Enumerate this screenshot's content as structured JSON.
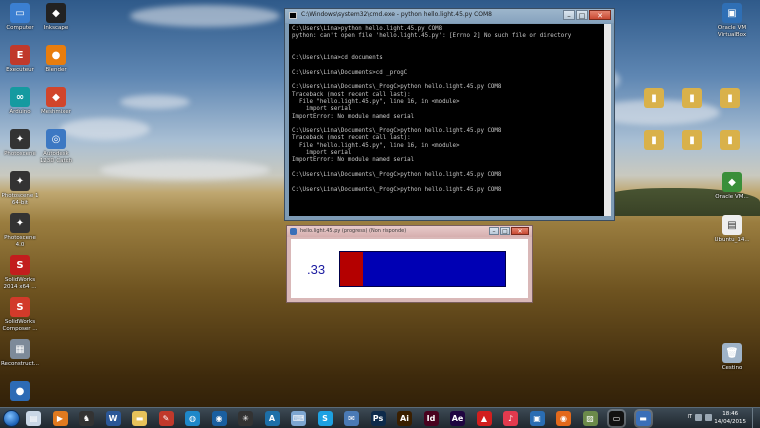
{
  "desktop": {
    "icons_left": [
      {
        "label": "Computer",
        "color": "#3b7fd1",
        "glyph": "▭"
      },
      {
        "label": "Executeur",
        "color": "#c0392b",
        "glyph": "E"
      },
      {
        "label": "Arduino",
        "color": "#159aa0",
        "glyph": "∞"
      },
      {
        "label": "Photoscene",
        "color": "#333333",
        "glyph": "✦"
      },
      {
        "label": "Photoscene 1 64-bit",
        "color": "#333333",
        "glyph": "✦"
      },
      {
        "label": "Photoscene 4.0",
        "color": "#333333",
        "glyph": "✦"
      },
      {
        "label": "SolidWorks 2014 x64 ...",
        "color": "#c21d1d",
        "glyph": "S"
      },
      {
        "label": "SolidWorks Composer ...",
        "color": "#d23a2a",
        "glyph": "S"
      },
      {
        "label": "Reconstruct...",
        "color": "#7d8a99",
        "glyph": "▦"
      },
      {
        "label": "",
        "color": "#2d6bb5",
        "glyph": "●"
      }
    ],
    "icons_left2": [
      {
        "label": "Inkscape",
        "color": "#222222",
        "glyph": "◆"
      },
      {
        "label": "Blender",
        "color": "#e87d0d",
        "glyph": "●"
      },
      {
        "label": "Meshmixer",
        "color": "#d1452b",
        "glyph": "◆"
      },
      {
        "label": "Autodesk 123D Catch",
        "color": "#3c78c3",
        "glyph": "◎"
      }
    ],
    "icons_mid": [
      {
        "label": "",
        "color": "#d9b14a",
        "glyph": "▮"
      },
      {
        "label": "",
        "color": "#d9b14a",
        "glyph": "▮"
      },
      {
        "label": "",
        "color": "#d9b14a",
        "glyph": "▮"
      },
      {
        "label": "",
        "color": "#d9b14a",
        "glyph": "▮"
      },
      {
        "label": "",
        "color": "#d9b14a",
        "glyph": "▮"
      },
      {
        "label": "",
        "color": "#d9b14a",
        "glyph": "▮"
      }
    ],
    "icons_right": [
      {
        "label": "Oracle VM VirtualBox",
        "color": "#2f6fb5",
        "glyph": "▣"
      },
      {
        "label": "Oracle VM...",
        "color": "#3a8f3a",
        "glyph": "◆"
      },
      {
        "label": "Ubuntu_14...",
        "color": "#eeeeee",
        "glyph": "▤"
      },
      {
        "label": "Cestino",
        "color": "#9fb3c8",
        "glyph": "🗑"
      }
    ]
  },
  "cmd": {
    "title": "C:\\Windows\\system32\\cmd.exe - python  hello.light.45.py COM8",
    "lines": [
      "C:\\Users\\Lina>python hello.light.45.py COM8",
      "python: can't open file 'hello.light.45.py': [Errno 2] No such file or directory",
      "",
      "",
      "C:\\Users\\Lina>cd documents",
      "",
      "C:\\Users\\Lina\\Documents>cd _progC",
      "",
      "C:\\Users\\Lina\\Documents\\_ProgC>python hello.light.45.py COM8",
      "Traceback (most recent call last):",
      "  File \"hello.light.45.py\", line 16, in <module>",
      "    import serial",
      "ImportError: No module named serial",
      "",
      "C:\\Users\\Lina\\Documents\\_ProgC>python hello.light.45.py COM8",
      "Traceback (most recent call last):",
      "  File \"hello.light.45.py\", line 16, in <module>",
      "    import serial",
      "ImportError: No module named serial",
      "",
      "C:\\Users\\Lina\\Documents\\_ProgC>python hello.light.45.py COM8",
      "",
      "C:\\Users\\Lina\\Documents\\_ProgC>python hello.light.45.py COM8"
    ],
    "buttons": {
      "min": "–",
      "max": "□",
      "close": "✕"
    }
  },
  "pywin": {
    "title": "hello.light.45.py (progress) (Non risponde)",
    "reading": ".33",
    "level": 0.14,
    "colors": {
      "fill": "#b40000",
      "track": "#0000b4"
    },
    "buttons": {
      "min": "–",
      "max": "□",
      "close": "✕"
    }
  },
  "taskbar": {
    "apps": [
      {
        "name": "explorer-icon",
        "color": "#c9d7e6",
        "glyph": "▤"
      },
      {
        "name": "media-player-icon",
        "color": "#e07a1f",
        "glyph": "▶"
      },
      {
        "name": "chess-icon",
        "color": "#333333",
        "glyph": "♞"
      },
      {
        "name": "word-icon",
        "color": "#2b5797",
        "glyph": "W"
      },
      {
        "name": "folder-icon",
        "color": "#e7c25a",
        "glyph": "▬"
      },
      {
        "name": "tool-icon",
        "color": "#c0392b",
        "glyph": "✎"
      },
      {
        "name": "globe-icon",
        "color": "#1e88c9",
        "glyph": "◍"
      },
      {
        "name": "earth-icon",
        "color": "#1a5fa0",
        "glyph": "◉"
      },
      {
        "name": "star-app-icon",
        "color": "#333333",
        "glyph": "✳"
      },
      {
        "name": "arduino-icon",
        "color": "#1d6fa8",
        "glyph": "A"
      },
      {
        "name": "keyboard-icon",
        "color": "#7da6d1",
        "glyph": "⌨"
      },
      {
        "name": "skype-icon",
        "color": "#1da1e2",
        "glyph": "S"
      },
      {
        "name": "mail-icon",
        "color": "#4a7ab5",
        "glyph": "✉"
      },
      {
        "name": "photoshop-icon",
        "color": "#0d2a4a",
        "glyph": "Ps"
      },
      {
        "name": "illustrator-icon",
        "color": "#3a1f00",
        "glyph": "Ai"
      },
      {
        "name": "indesign-icon",
        "color": "#49021f",
        "glyph": "Id"
      },
      {
        "name": "aftereffects-icon",
        "color": "#1f0540",
        "glyph": "Ae"
      },
      {
        "name": "acrobat-icon",
        "color": "#d21e1e",
        "glyph": "▲"
      },
      {
        "name": "itunes-icon",
        "color": "#e23a4e",
        "glyph": "♪"
      },
      {
        "name": "app-blue-icon",
        "color": "#2a6db3",
        "glyph": "▣"
      },
      {
        "name": "firefox-icon",
        "color": "#e3691b",
        "glyph": "◉"
      },
      {
        "name": "image-viewer-icon",
        "color": "#6b8a4a",
        "glyph": "▨"
      },
      {
        "name": "cmd-icon",
        "color": "#111111",
        "glyph": "▭"
      },
      {
        "name": "python-icon",
        "color": "#3a6fb8",
        "glyph": "▬"
      }
    ],
    "clock_time": "18:46",
    "clock_date": "14/04/2015",
    "tray_label": "IT"
  }
}
